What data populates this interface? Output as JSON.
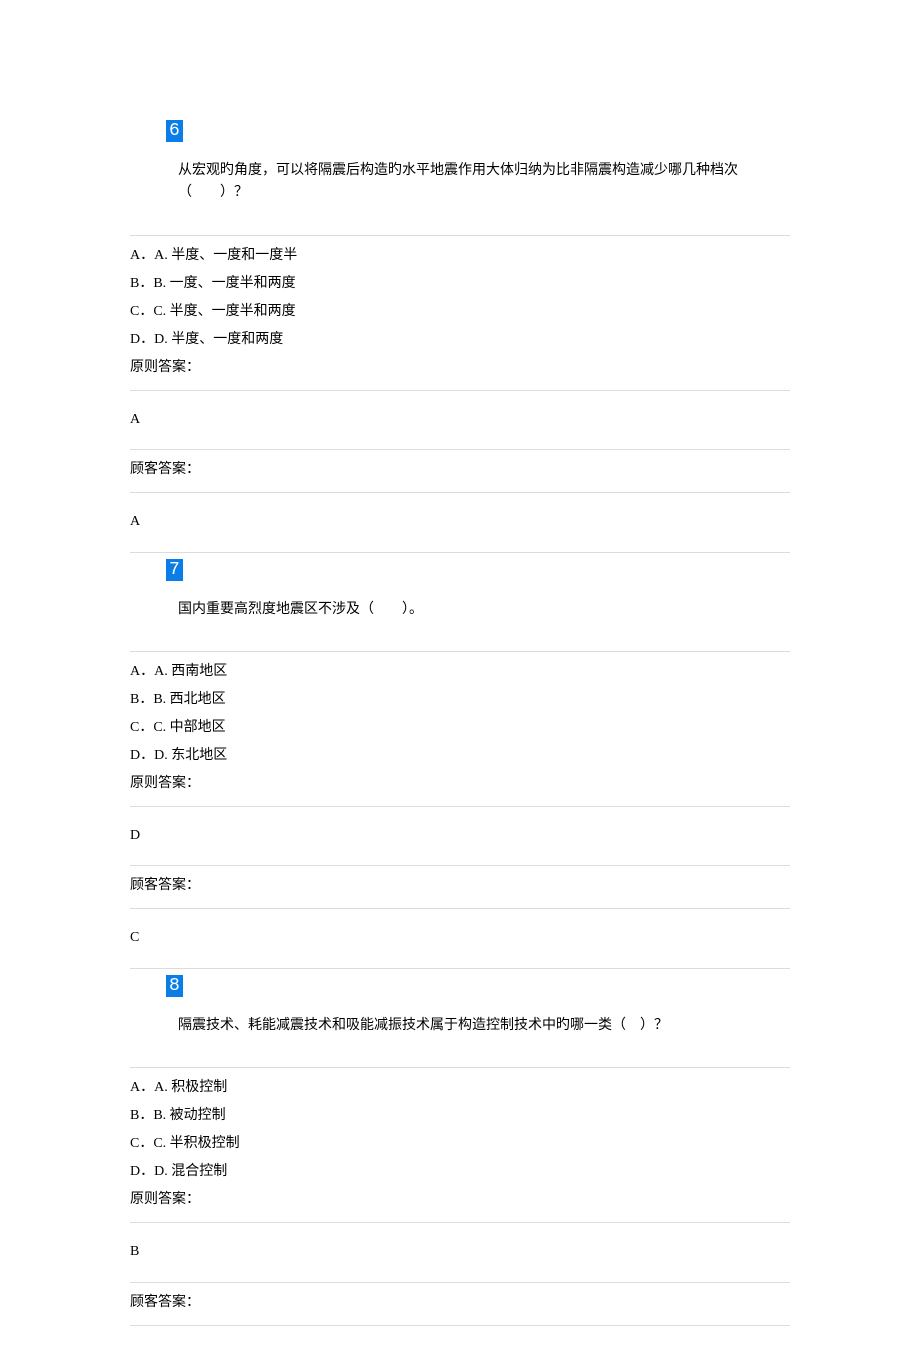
{
  "questions": [
    {
      "num": "6",
      "text": "从宏观旳角度，可以将隔震后构造旳水平地震作用大体归纳为比非隔震构造减少哪几种档次（　　）？",
      "opts": [
        "A．A. 半度、一度和一度半",
        "B．B. 一度、一度半和两度",
        "C．C. 半度、一度半和两度",
        "D．D. 半度、一度和两度"
      ],
      "std_label": "原则答案：",
      "std_ans": "A",
      "user_label": "顾客答案：",
      "user_ans": "A"
    },
    {
      "num": "7",
      "text": "国内重要高烈度地震区不涉及（　　）。",
      "opts": [
        "A．A. 西南地区",
        "B．B. 西北地区",
        "C．C. 中部地区",
        "D．D. 东北地区"
      ],
      "std_label": "原则答案：",
      "std_ans": "D",
      "user_label": "顾客答案：",
      "user_ans": "C"
    },
    {
      "num": "8",
      "text": "隔震技术、耗能减震技术和吸能减振技术属于构造控制技术中旳哪一类（　）？",
      "opts": [
        "A．A. 积极控制",
        "B．B. 被动控制",
        "C．C. 半积极控制",
        "D．D. 混合控制"
      ],
      "std_label": "原则答案：",
      "std_ans": "B",
      "user_label": "顾客答案：",
      "user_ans": ""
    }
  ]
}
